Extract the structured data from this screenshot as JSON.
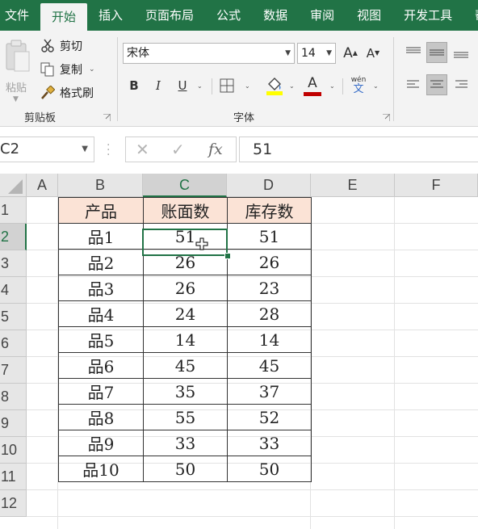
{
  "tabs": [
    "文件",
    "开始",
    "插入",
    "页面布局",
    "公式",
    "数据",
    "审阅",
    "视图",
    "开发工具",
    "帮"
  ],
  "active_tab_index": 1,
  "clipboard": {
    "paste_label": "粘贴",
    "cut_label": "剪切",
    "copy_label": "复制",
    "format_painter_label": "格式刷",
    "group_label": "剪贴板"
  },
  "font": {
    "font_name": "宋体",
    "font_size": "14",
    "bold": "B",
    "italic": "I",
    "underline": "U",
    "grow_label": "A",
    "shrink_label": "A",
    "font_color_label": "A",
    "phonetic_top": "wén",
    "phonetic_bottom": "文",
    "group_label": "字体"
  },
  "formula_bar": {
    "name_box": "C2",
    "cancel": "✕",
    "enter": "✓",
    "fx": "fx",
    "value": "51"
  },
  "columns": [
    "A",
    "B",
    "C",
    "D",
    "E",
    "F"
  ],
  "rows": [
    "1",
    "2",
    "3",
    "4",
    "5",
    "6",
    "7",
    "8",
    "9",
    "10",
    "11",
    "12"
  ],
  "selected": {
    "column": "C",
    "row": "2"
  },
  "table": {
    "headers": [
      "产品",
      "账面数",
      "库存数"
    ],
    "rows": [
      [
        "品1",
        "51",
        "51"
      ],
      [
        "品2",
        "26",
        "26"
      ],
      [
        "品3",
        "26",
        "23"
      ],
      [
        "品4",
        "24",
        "28"
      ],
      [
        "品5",
        "14",
        "14"
      ],
      [
        "品6",
        "45",
        "45"
      ],
      [
        "品7",
        "35",
        "37"
      ],
      [
        "品8",
        "55",
        "52"
      ],
      [
        "品9",
        "33",
        "33"
      ],
      [
        "品10",
        "50",
        "50"
      ]
    ]
  },
  "colors": {
    "brand": "#217346",
    "header_fill": "#fbe3d6",
    "highlight_yellow": "#ffff00",
    "font_red": "#c00000"
  }
}
